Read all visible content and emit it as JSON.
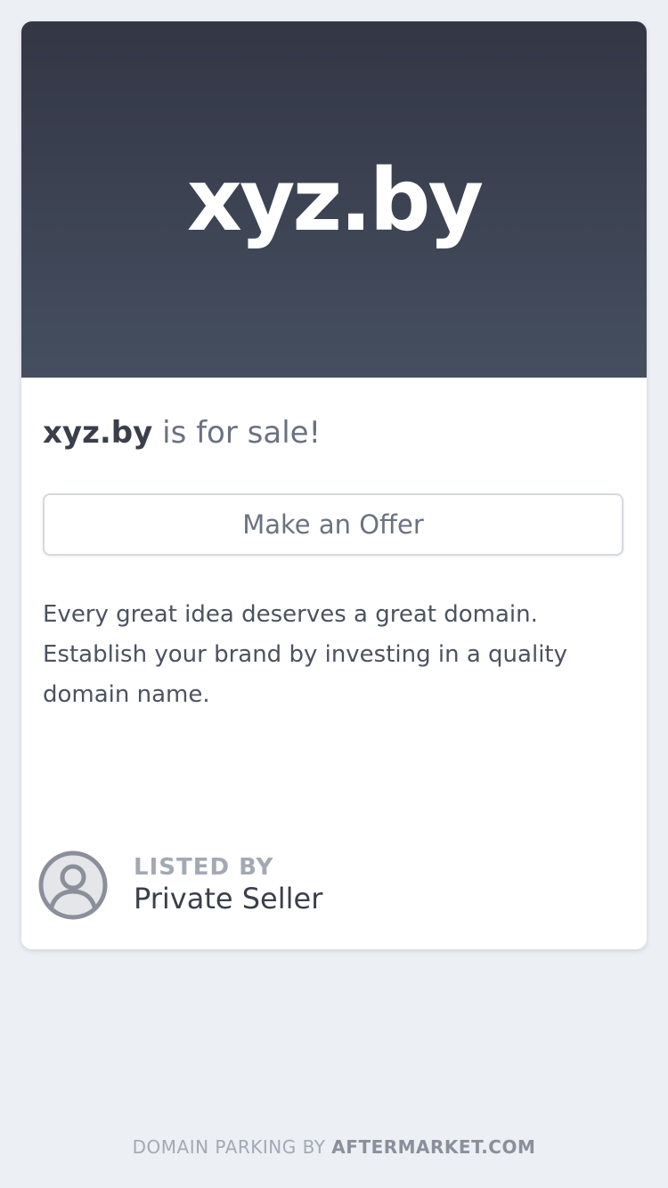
{
  "hero": {
    "domain": "xyz.by",
    "gradient_top": "#333645",
    "gradient_bottom": "#454f60"
  },
  "headline": {
    "domain": "xyz.by",
    "suffix": " is for sale!"
  },
  "offer_button": {
    "label": "Make an Offer"
  },
  "description": "Every great idea deserves a great domain. Establish your brand by investing in a quality domain name.",
  "seller": {
    "icon": "user-circle-icon",
    "listed_by_label": "LISTED BY",
    "name": "Private Seller"
  },
  "footer": {
    "prefix": "DOMAIN PARKING BY ",
    "brand": "AFTERMARKET.COM"
  }
}
